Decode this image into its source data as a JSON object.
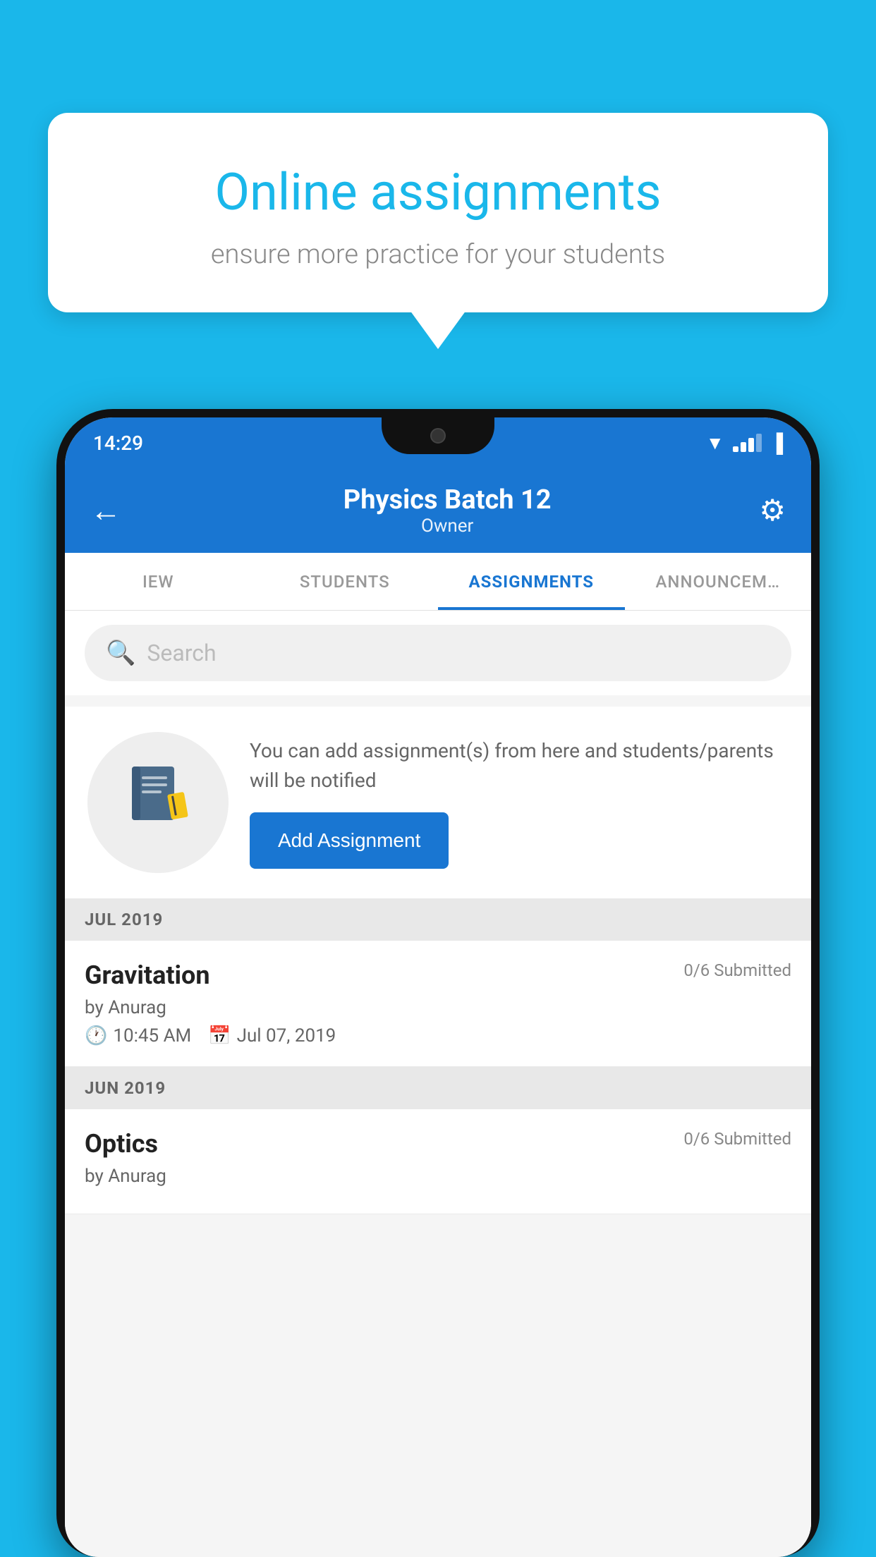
{
  "background_color": "#1ab7ea",
  "speech_bubble": {
    "title": "Online assignments",
    "subtitle": "ensure more practice for your students"
  },
  "status_bar": {
    "time": "14:29"
  },
  "app_header": {
    "title": "Physics Batch 12",
    "subtitle": "Owner",
    "back_label": "←",
    "settings_label": "⚙"
  },
  "tabs": [
    {
      "label": "IEW",
      "active": false
    },
    {
      "label": "STUDENTS",
      "active": false
    },
    {
      "label": "ASSIGNMENTS",
      "active": true
    },
    {
      "label": "ANNOUNCEM…",
      "active": false
    }
  ],
  "search": {
    "placeholder": "Search"
  },
  "info_card": {
    "description": "You can add assignment(s) from here and students/parents will be notified",
    "button_label": "Add Assignment"
  },
  "sections": [
    {
      "month_label": "JUL 2019",
      "assignments": [
        {
          "title": "Gravitation",
          "submitted": "0/6 Submitted",
          "author": "by Anurag",
          "time": "10:45 AM",
          "date": "Jul 07, 2019"
        }
      ]
    },
    {
      "month_label": "JUN 2019",
      "assignments": [
        {
          "title": "Optics",
          "submitted": "0/6 Submitted",
          "author": "by Anurag",
          "time": "",
          "date": ""
        }
      ]
    }
  ],
  "icons": {
    "back": "←",
    "settings": "⚙",
    "search": "🔍",
    "clock": "🕐",
    "calendar": "📅",
    "notebook": "📓"
  }
}
